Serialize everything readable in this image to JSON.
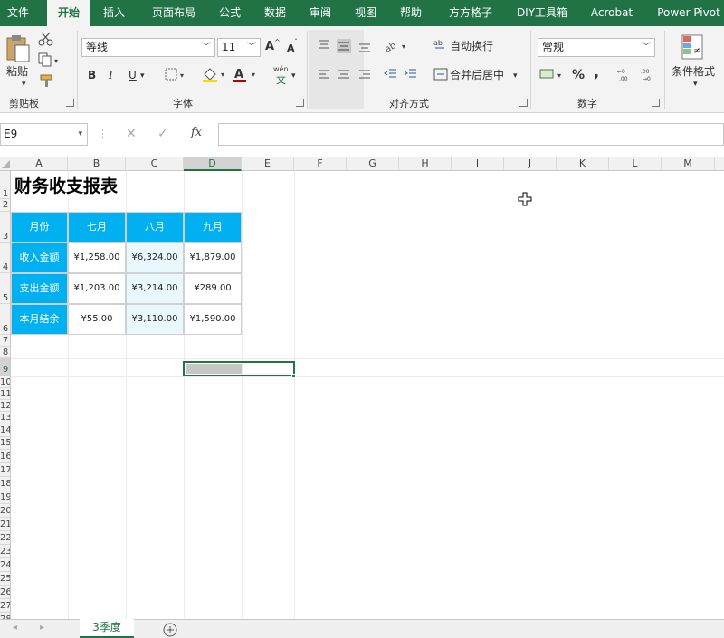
{
  "ribbon_tabs": [
    "文件",
    "开始",
    "插入",
    "页面布局",
    "公式",
    "数据",
    "审阅",
    "视图",
    "帮助",
    "方方格子",
    "DIY工具箱",
    "Acrobat",
    "Power Pivot"
  ],
  "active_tab": "开始",
  "clipboard": {
    "paste_label": "粘贴",
    "group_label": "剪贴板"
  },
  "font": {
    "name": "等线",
    "size": "11",
    "group_label": "字体",
    "bold": "B",
    "italic": "I",
    "underline": "U",
    "grow": "A",
    "shrink": "A",
    "phonetic_top": "wén",
    "phonetic_bottom": "文"
  },
  "alignment": {
    "wrap_label": "自动换行",
    "merge_label": "合并后居中",
    "group_label": "对齐方式"
  },
  "number": {
    "format": "常规",
    "group_label": "数字",
    "percent": "%",
    "comma": ","
  },
  "styles": {
    "conditional_label": "条件格式"
  },
  "formula_bar": {
    "name_box": "E9",
    "fx": "fx",
    "content": ""
  },
  "columns": [
    "A",
    "B",
    "C",
    "D",
    "E",
    "F",
    "G",
    "H",
    "I",
    "J",
    "K",
    "L",
    "M"
  ],
  "selected_column": "D",
  "rows": [
    "1",
    "2",
    "3",
    "4",
    "5",
    "6",
    "7",
    "8",
    "9",
    "10",
    "11",
    "12",
    "13",
    "14",
    "15",
    "16",
    "17",
    "18",
    "19",
    "20",
    "21",
    "22",
    "23",
    "24",
    "25",
    "26",
    "27",
    "28",
    "29",
    "30",
    "31",
    "32"
  ],
  "selected_row": "9",
  "sheet": {
    "title": "财务收支报表",
    "headers": [
      "月份",
      "七月",
      "八月",
      "九月"
    ],
    "rows": [
      [
        "收入金额",
        "¥1,258.00",
        "¥6,324.00",
        "¥1,879.00"
      ],
      [
        "支出金额",
        "¥1,203.00",
        "¥3,214.00",
        "¥289.00"
      ],
      [
        "本月结余",
        "¥55.00",
        "¥3,110.00",
        "¥1,590.00"
      ]
    ]
  },
  "sheet_tabs": [
    "3季度"
  ],
  "colors": {
    "excel_green": "#217346",
    "header_blue": "#00b0f0",
    "light_blue": "#e8f8fd"
  }
}
